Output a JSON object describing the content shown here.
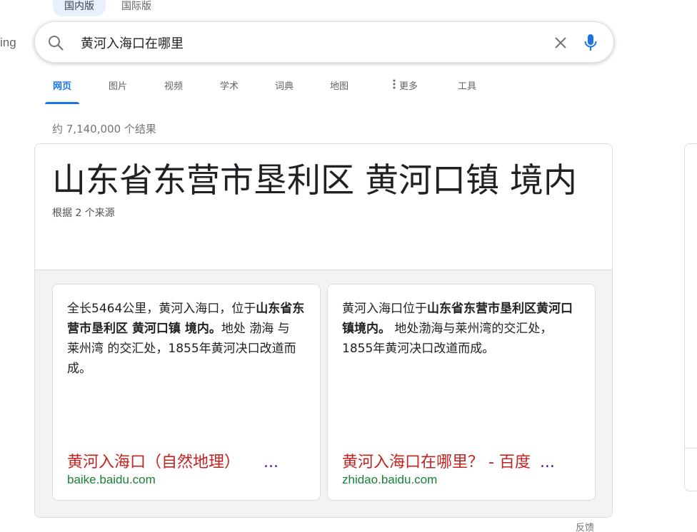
{
  "top_tabs": [
    {
      "label": "国内版",
      "active": true
    },
    {
      "label": "国际版",
      "active": false
    }
  ],
  "logo_fragment": "ing",
  "search": {
    "query": "黄河入海口在哪里"
  },
  "nav": [
    {
      "label": "网页",
      "active": true
    },
    {
      "label": "图片",
      "active": false
    },
    {
      "label": "视频",
      "active": false
    },
    {
      "label": "学术",
      "active": false
    },
    {
      "label": "词典",
      "active": false
    },
    {
      "label": "地图",
      "active": false
    },
    {
      "label": "更多",
      "active": false
    },
    {
      "label": "工具",
      "active": false
    }
  ],
  "result_stats": "约 7,140,000 个结果",
  "answer": {
    "title": "山东省东营市垦利区 黄河口镇 境内",
    "sources": "根据 2 个来源"
  },
  "cards": [
    {
      "text_1": "全长5464公里，黄河入海口，位于",
      "text_bold": "山东省东营市垦利区 黄河口镇 境内。",
      "text_2": "地处 渤海 与 莱州湾 的交汇处，1855年黄河决口改道而成。",
      "link_title": "黄河入海口（自然地理）",
      "link_ellipsis": "...",
      "domain": "baike.baidu.com"
    },
    {
      "text_1": "黄河入海口位于",
      "text_bold": "山东省东营市垦利区黄河口镇境内。",
      "text_2": " 地处渤海与莱州湾的交汇处，1855年黄河决口改道而成。",
      "link_title": "黄河入海口在哪里？ - 百度",
      "link_ellipsis": "...",
      "domain": "zhidao.baidu.com"
    }
  ],
  "feedback": "反馈",
  "colors": {
    "accent": "#1a73e8",
    "link": "#c5221f",
    "domain": "#188038",
    "visited": "#4b11a8"
  }
}
